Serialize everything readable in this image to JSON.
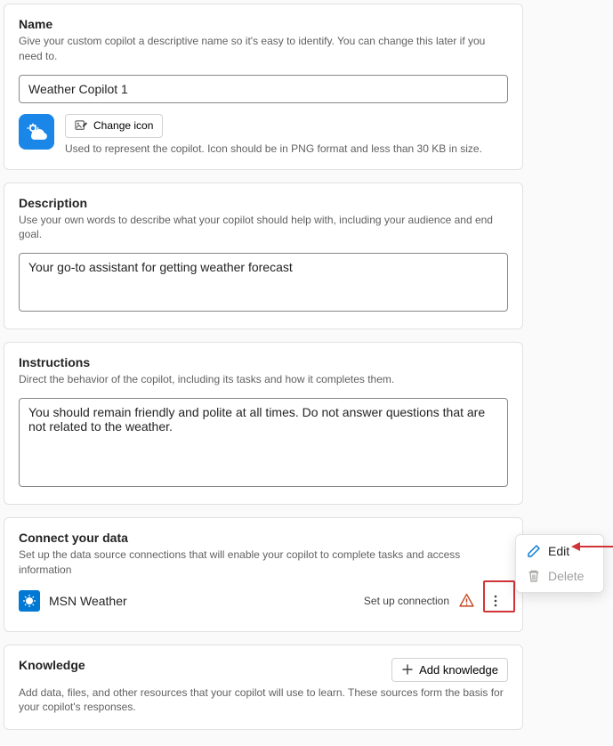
{
  "name_section": {
    "title": "Name",
    "desc": "Give your custom copilot a descriptive name so it's easy to identify. You can change this later if you need to.",
    "value": "Weather Copilot 1",
    "change_icon_label": "Change icon",
    "icon_help": "Used to represent the copilot. Icon should be in PNG format and less than 30 KB in size.",
    "icon_bg": "#1a86e8"
  },
  "description_section": {
    "title": "Description",
    "desc": "Use your own words to describe what your copilot should help with, including your audience and end goal.",
    "value": "Your go-to assistant for getting weather forecast"
  },
  "instructions_section": {
    "title": "Instructions",
    "desc": "Direct the behavior of the copilot, including its tasks and how it completes them.",
    "value": "You should remain friendly and polite at all times. Do not answer questions that are not related to the weather."
  },
  "connect_section": {
    "title": "Connect your data",
    "desc": "Set up the data source connections that will enable your copilot to complete tasks and access information",
    "source_name": "MSN Weather",
    "status_text": "Set up connection"
  },
  "knowledge_section": {
    "title": "Knowledge",
    "add_label": "Add knowledge",
    "desc": "Add data, files, and other resources that your copilot will use to learn. These sources form the basis for your copilot's responses."
  },
  "context_menu": {
    "edit": "Edit",
    "delete": "Delete"
  },
  "colors": {
    "accent": "#0078d4",
    "warn": "#c4471e",
    "highlight": "#d13438",
    "disabled": "#a19f9d"
  }
}
